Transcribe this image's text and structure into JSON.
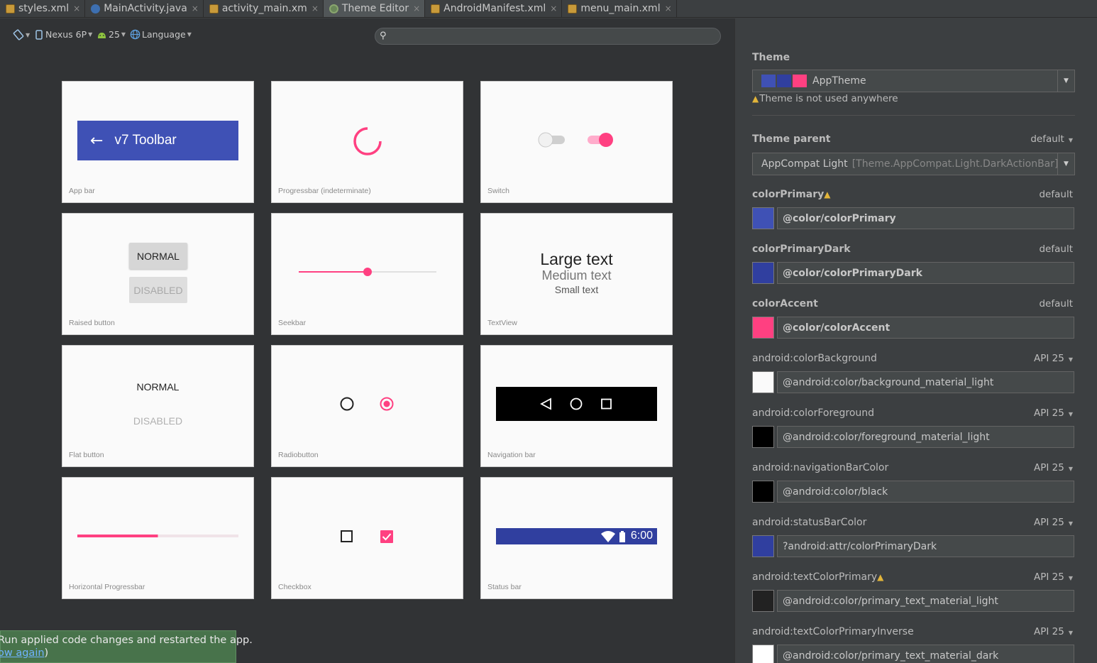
{
  "tabs": [
    {
      "label": "styles.xml",
      "icon": "xml-file-icon",
      "active": false
    },
    {
      "label": "MainActivity.java",
      "icon": "java-class-icon",
      "active": false
    },
    {
      "label": "activity_main.xml",
      "icon": "xml-file-icon",
      "active": false
    },
    {
      "label": "Theme Editor",
      "icon": "theme-editor-icon",
      "active": true
    },
    {
      "label": "AndroidManifest.xml",
      "icon": "xml-file-icon",
      "active": false
    },
    {
      "label": "menu_main.xml",
      "icon": "xml-file-icon",
      "active": false
    }
  ],
  "toolbar": {
    "device": "Nexus 6P",
    "api": "25",
    "language": "Language"
  },
  "cards": {
    "appbar": {
      "label": "App bar",
      "toolbar_title": "v7 Toolbar"
    },
    "progress": {
      "label": "Progressbar (indeterminate)"
    },
    "switch": {
      "label": "Switch"
    },
    "raised": {
      "label": "Raised button",
      "normal": "NORMAL",
      "disabled": "DISABLED"
    },
    "seekbar": {
      "label": "Seekbar",
      "value": 0.5
    },
    "textview": {
      "label": "TextView",
      "large": "Large text",
      "medium": "Medium text",
      "small": "Small text"
    },
    "flat": {
      "label": "Flat button",
      "normal": "NORMAL",
      "disabled": "DISABLED"
    },
    "radio": {
      "label": "Radiobutton"
    },
    "navbar": {
      "label": "Navigation bar"
    },
    "hprogress": {
      "label": "Horizontal Progressbar",
      "value": 0.5
    },
    "checkbox": {
      "label": "Checkbox"
    },
    "statusbar": {
      "label": "Status bar",
      "time": "6:00"
    }
  },
  "toast": {
    "line1": "Run applied code changes and restarted the app.",
    "link": "ow again",
    "suffix": ")"
  },
  "panel": {
    "theme_title": "Theme",
    "theme_value": "AppTheme",
    "theme_warning": "Theme is not used anywhere",
    "parent_title": "Theme parent",
    "parent_default": "default",
    "parent_value": "AppCompat Light",
    "parent_detail": "[Theme.AppCompat.Light.DarkActionBar]",
    "attributes": [
      {
        "name": "colorPrimary",
        "right": "default",
        "value": "@color/colorPrimary",
        "color": "#3f51b5",
        "bold": true,
        "warn": true
      },
      {
        "name": "colorPrimaryDark",
        "right": "default",
        "value": "@color/colorPrimaryDark",
        "color": "#303f9f",
        "bold": true,
        "warn": false
      },
      {
        "name": "colorAccent",
        "right": "default",
        "value": "@color/colorAccent",
        "color": "#ff4081",
        "bold": true,
        "warn": false
      },
      {
        "name": "android:colorBackground",
        "right": "API 25",
        "value": "@android:color/background_material_light",
        "color": "#fafafa",
        "bold": false,
        "warn": false
      },
      {
        "name": "android:colorForeground",
        "right": "API 25",
        "value": "@android:color/foreground_material_light",
        "color": "#000000",
        "bold": false,
        "warn": false
      },
      {
        "name": "android:navigationBarColor",
        "right": "API 25",
        "value": "@android:color/black",
        "color": "#000000",
        "bold": false,
        "warn": false
      },
      {
        "name": "android:statusBarColor",
        "right": "API 25",
        "value": "?android:attr/colorPrimaryDark",
        "color": "#303f9f",
        "bold": false,
        "warn": false
      },
      {
        "name": "android:textColorPrimary",
        "right": "API 25",
        "value": "@android:color/primary_text_material_light",
        "color": "#222222",
        "bold": false,
        "warn": true
      },
      {
        "name": "android:textColorPrimaryInverse",
        "right": "API 25",
        "value": "@android:color/primary_text_material_dark",
        "color": "#ffffff",
        "bold": false,
        "warn": false
      }
    ]
  },
  "colors": {
    "primary": "#3f51b5",
    "primary_dark": "#303f9f",
    "accent": "#ff4081"
  }
}
